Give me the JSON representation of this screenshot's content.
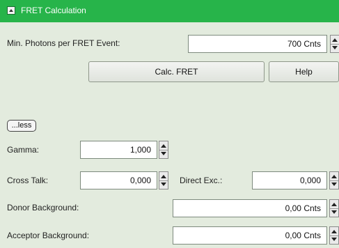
{
  "panel": {
    "title": "FRET Calculation"
  },
  "min_photons": {
    "label": "Min. Photons per FRET Event:",
    "value": "700 Cnts"
  },
  "buttons": {
    "calc": "Calc. FRET",
    "help": "Help",
    "less": "...less"
  },
  "gamma": {
    "label": "Gamma:",
    "value": "1,000"
  },
  "cross_talk": {
    "label": "Cross Talk:",
    "value": "0,000"
  },
  "direct_exc": {
    "label": "Direct Exc.:",
    "value": "0,000"
  },
  "donor_bg": {
    "label": "Donor Background:",
    "value": "0,00 Cnts"
  },
  "acceptor_bg": {
    "label": "Acceptor Background:",
    "value": "0,00 Cnts"
  }
}
